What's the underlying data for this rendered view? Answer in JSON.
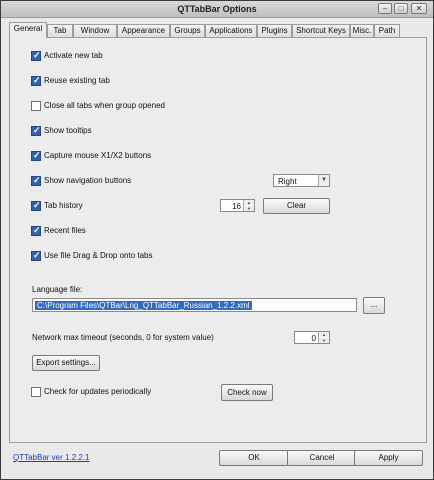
{
  "window": {
    "title": "QTTabBar Options",
    "minimize_icon": "minimize-icon",
    "maximize_icon": "maximize-icon",
    "close_icon": "close-icon"
  },
  "tabs": [
    {
      "label": "General",
      "active": true
    },
    {
      "label": "Tab"
    },
    {
      "label": "Window"
    },
    {
      "label": "Appearance"
    },
    {
      "label": "Groups"
    },
    {
      "label": "Applications"
    },
    {
      "label": "Plugins"
    },
    {
      "label": "Shortcut Keys"
    },
    {
      "label": "Misc."
    },
    {
      "label": "Path"
    }
  ],
  "general": {
    "activate_new_tab": {
      "label": "Activate new tab",
      "checked": true
    },
    "reuse_existing_tab": {
      "label": "Reuse existing tab",
      "checked": true
    },
    "close_all_tabs": {
      "label": "Close all tabs when group opened",
      "checked": false
    },
    "show_tooltips": {
      "label": "Show tooltips",
      "checked": true
    },
    "capture_mouse": {
      "label": "Capture mouse X1/X2 buttons",
      "checked": true
    },
    "show_nav_buttons": {
      "label": "Show navigation buttons",
      "checked": true
    },
    "nav_position": {
      "value": "Right"
    },
    "tab_history": {
      "label": "Tab history",
      "checked": true,
      "value": "16"
    },
    "clear_button": "Clear",
    "recent_files": {
      "label": "Recent files",
      "checked": true
    },
    "file_drag_drop": {
      "label": "Use file Drag & Drop onto tabs",
      "checked": true
    },
    "language_file_label": "Language file:",
    "language_file_value": "C:\\Program Files\\QTBar\\Lng_QTTabBar_Russian_1.2.2.xml",
    "browse_button": "...",
    "network_timeout_label": "Network max timeout (seconds, 0 for system value)",
    "network_timeout_value": "0",
    "export_button": "Export settings...",
    "check_updates": {
      "label": "Check for updates periodically",
      "checked": false
    },
    "check_now_button": "Check now"
  },
  "footer": {
    "version_link": "QTTabBar ver 1.2.2.1",
    "ok": "OK",
    "cancel": "Cancel",
    "apply": "Apply"
  },
  "colors": {
    "checkbox_checked": "#2f63b4",
    "selection": "#316ac5",
    "link": "#1a3ad1"
  }
}
